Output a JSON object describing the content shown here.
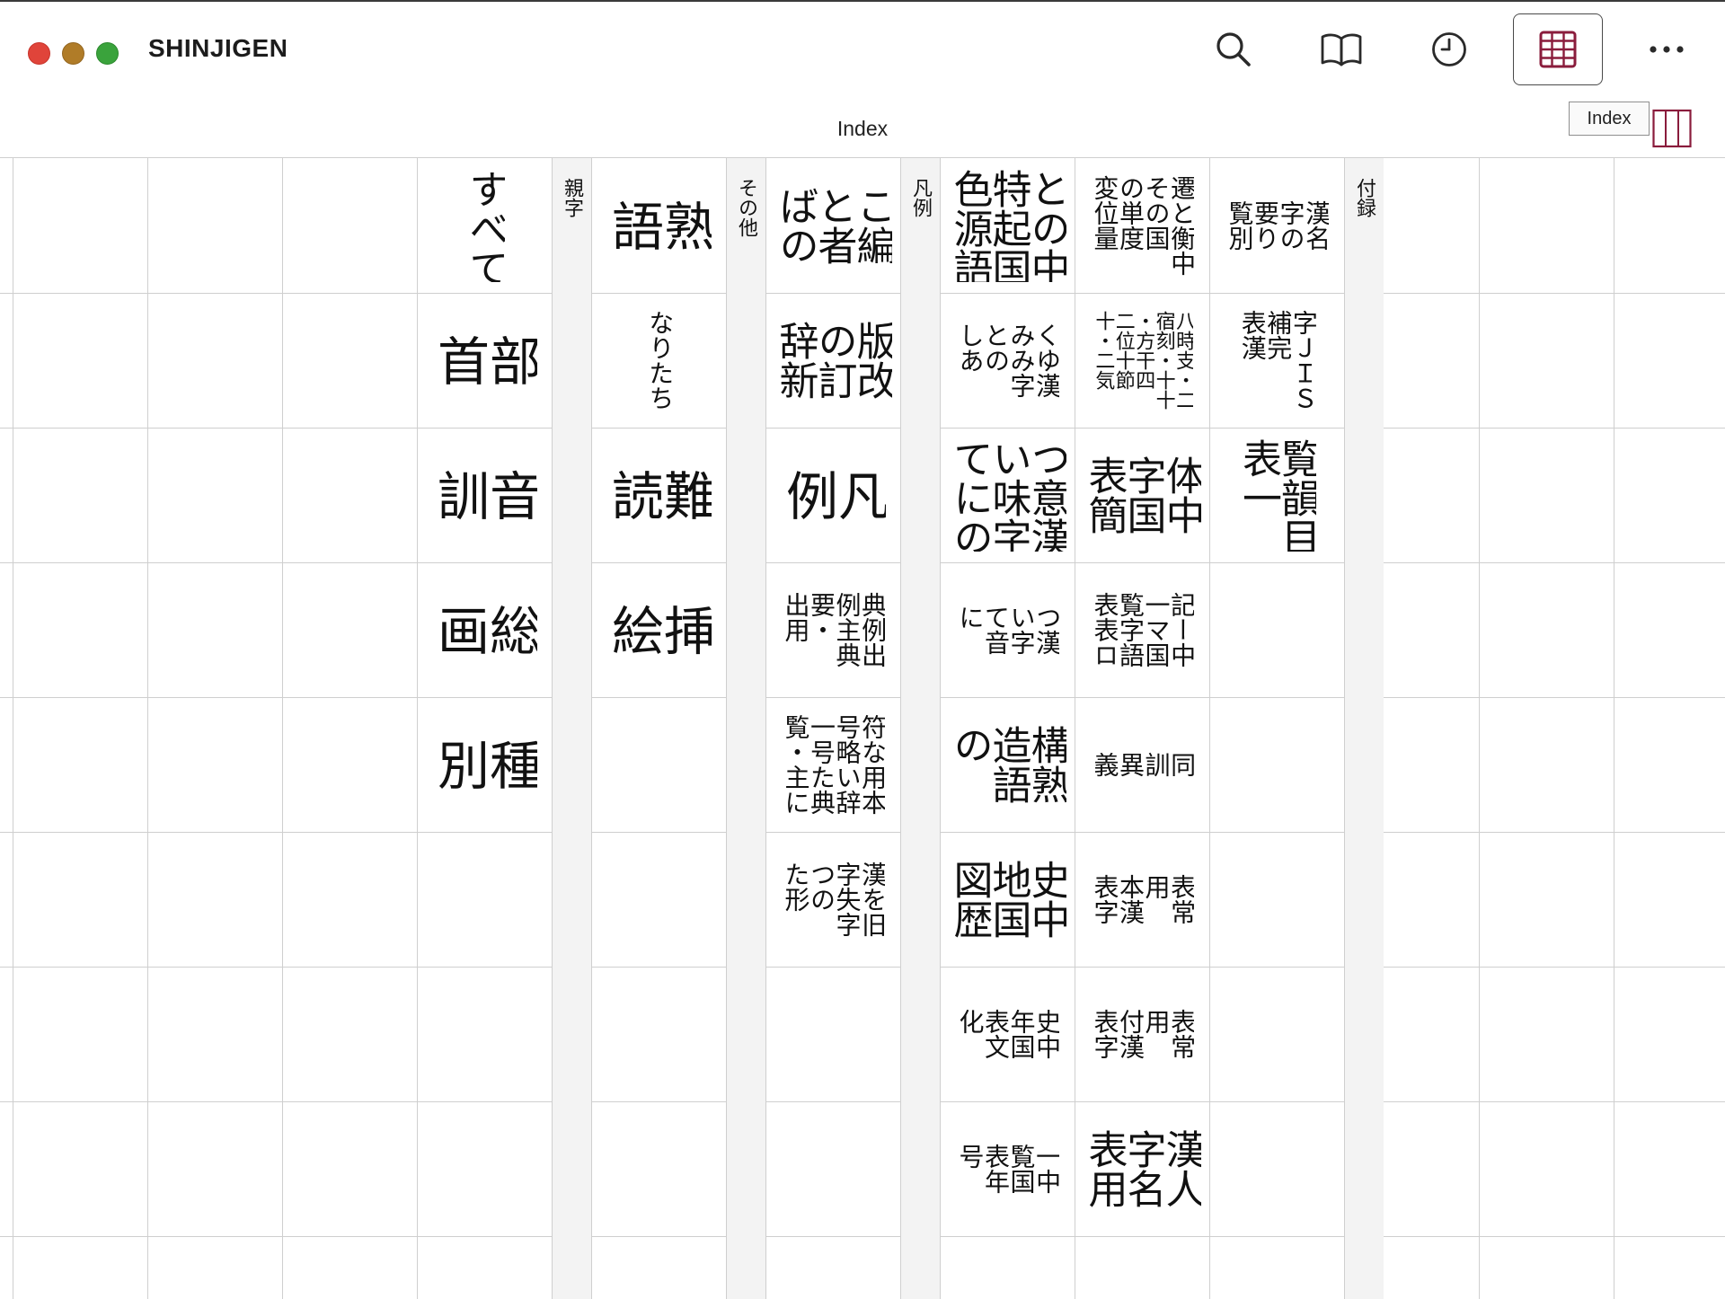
{
  "window": {
    "title": "SHINJIGEN",
    "view_label": "Index",
    "tooltip": "Index"
  },
  "toolbar": {
    "icons": [
      "search-icon",
      "book-icon",
      "history-icon",
      "index-grid-icon",
      "more-icon"
    ],
    "active": "index-grid-icon",
    "accent_color": "#8a1c3c"
  },
  "sections": [
    {
      "label": "付録",
      "columns": [
        [
          {
            "text": "漢名\n字の\n要り\n覧別",
            "size": "m"
          },
          {
            "text": "字ＪＩＳ\n補完\n表漢",
            "size": "m"
          },
          {
            "text": "覧韻目\n表一",
            "size": "l"
          }
        ],
        [
          {
            "text": "遷と衡中\nその国\nの単度\n変位量",
            "size": "m"
          },
          {
            "text": "八時支・二\n宿刻・十十\n・方干四\n二位十節\n十・二気",
            "size": "s"
          },
          {
            "text": "体中\n字国\n表簡",
            "size": "l"
          },
          {
            "text": "記ー中\n一マ国\n覧字語\n表表ロ",
            "size": "m"
          },
          {
            "text": "同\n訓\n異\n義",
            "size": "m"
          },
          {
            "text": "表常\n用\n本漢\n表字",
            "size": "m"
          },
          {
            "text": "表常\n用\n付漢\n表字",
            "size": "m"
          },
          {
            "text": "漢人\n字名\n表用",
            "size": "l"
          }
        ],
        [
          {
            "text": "との中\n特起国\n色源語",
            "size": "l"
          },
          {
            "text": "くゆ漢\nみみ字\nとの\nしあ",
            "size": "m"
          },
          {
            "text": "つ意漢\nい味字\nてにの",
            "size": "l"
          },
          {
            "text": "つ漢\nい字\nて音\nに",
            "size": "m"
          },
          {
            "text": "構熟\n造語\nの",
            "size": "l"
          },
          {
            "text": "史中\n地国\n図歴",
            "size": "l"
          },
          {
            "text": "史中\n年国\n表文\n化",
            "size": "m"
          },
          {
            "text": "一中\n覧国\n表年\n号",
            "size": "m"
          }
        ]
      ]
    },
    {
      "label": "凡例",
      "columns": [
        [
          {
            "text": "こ編\nと者\nばの",
            "size": "l"
          },
          {
            "text": "版改\nの訂\n辞新",
            "size": "l"
          },
          {
            "text": "凡\n例",
            "size": "xl"
          },
          {
            "text": "典例出\n例主典\n要・\n出用",
            "size": "m"
          },
          {
            "text": "符な用本\n号略い辞\n一号た典\n覧・主に",
            "size": "m"
          },
          {
            "text": "漢を旧\n字失字\nつの\nた形",
            "size": "m"
          }
        ]
      ]
    },
    {
      "label": "その他",
      "columns": [
        [
          {
            "text": "熟\n語",
            "size": "xl"
          },
          {
            "text": "なりたち",
            "size": "m"
          },
          {
            "text": "難\n読",
            "size": "xl"
          },
          {
            "text": "挿\n絵",
            "size": "xl"
          }
        ]
      ]
    },
    {
      "label": "親字",
      "columns": [
        [
          {
            "text": "すべて",
            "size": "l"
          },
          {
            "text": "部\n首",
            "size": "xl"
          },
          {
            "text": "音\n訓",
            "size": "xl"
          },
          {
            "text": "総\n画",
            "size": "xl"
          },
          {
            "text": "種\n別",
            "size": "xl"
          }
        ]
      ]
    }
  ]
}
